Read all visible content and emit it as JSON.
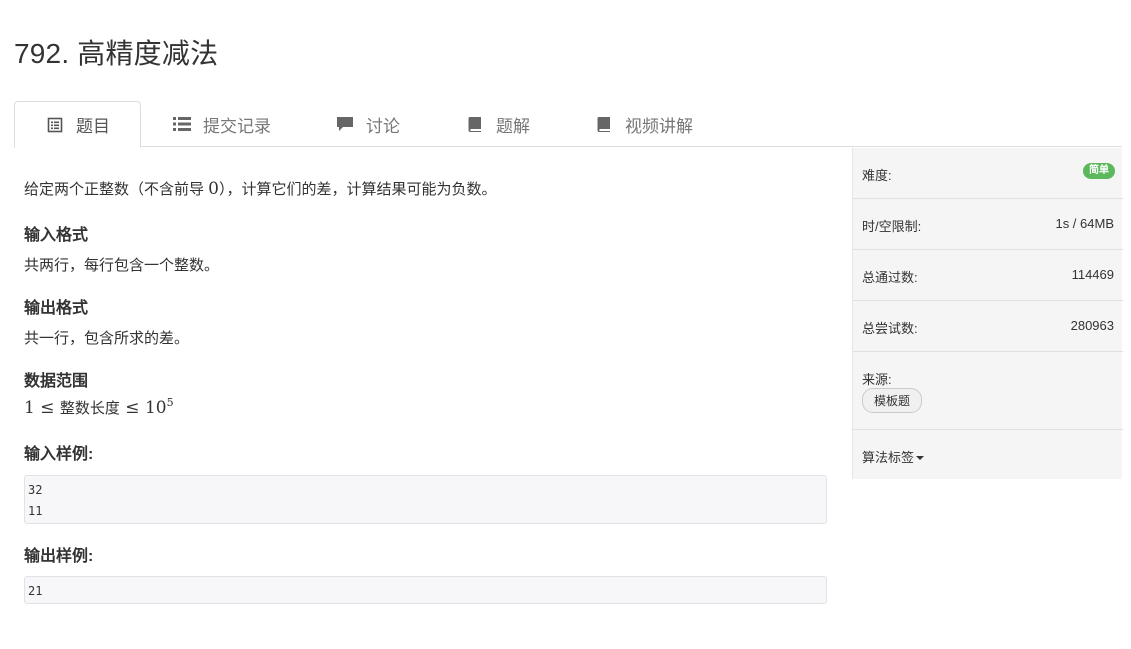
{
  "problem": {
    "title": "792. 高精度减法"
  },
  "tabs": [
    {
      "label": "题目",
      "icon": "list-alt-icon"
    },
    {
      "label": "提交记录",
      "icon": "list-icon"
    },
    {
      "label": "讨论",
      "icon": "comment-icon"
    },
    {
      "label": "题解",
      "icon": "book-icon"
    },
    {
      "label": "视频讲解",
      "icon": "book-icon"
    }
  ],
  "description": {
    "intro_a": "给定两个正整数（不含前导 ",
    "intro_zero": "0",
    "intro_b": "），计算它们的差，计算结果可能为负数。",
    "input_heading": "输入格式",
    "input_text": "共两行，每行包含一个整数。",
    "output_heading": "输出格式",
    "output_text": "共一行，包含所求的差。",
    "range_heading": "数据范围",
    "range_a": "1 ≤ ",
    "range_b": "整数长度",
    "range_c": " ≤ 10",
    "range_exp": "5",
    "sample_in_heading": "输入样例:",
    "sample_in_line1": "32",
    "sample_in_line2": "11",
    "sample_out_heading": "输出样例:",
    "sample_out_line1": "21"
  },
  "sidebar": {
    "difficulty_label": "难度:",
    "difficulty_value": "简单",
    "limit_label": "时/空限制:",
    "limit_value": "1s / 64MB",
    "passed_label": "总通过数:",
    "passed_value": "114469",
    "attempts_label": "总尝试数:",
    "attempts_value": "280963",
    "source_label": "来源:",
    "source_tag": "模板题",
    "algo_tags_label": "算法标签"
  },
  "colors": {
    "easy_badge": "#5cb85c",
    "sidebar_bg": "#f5f5f5",
    "code_bg": "#f7f7f9"
  }
}
